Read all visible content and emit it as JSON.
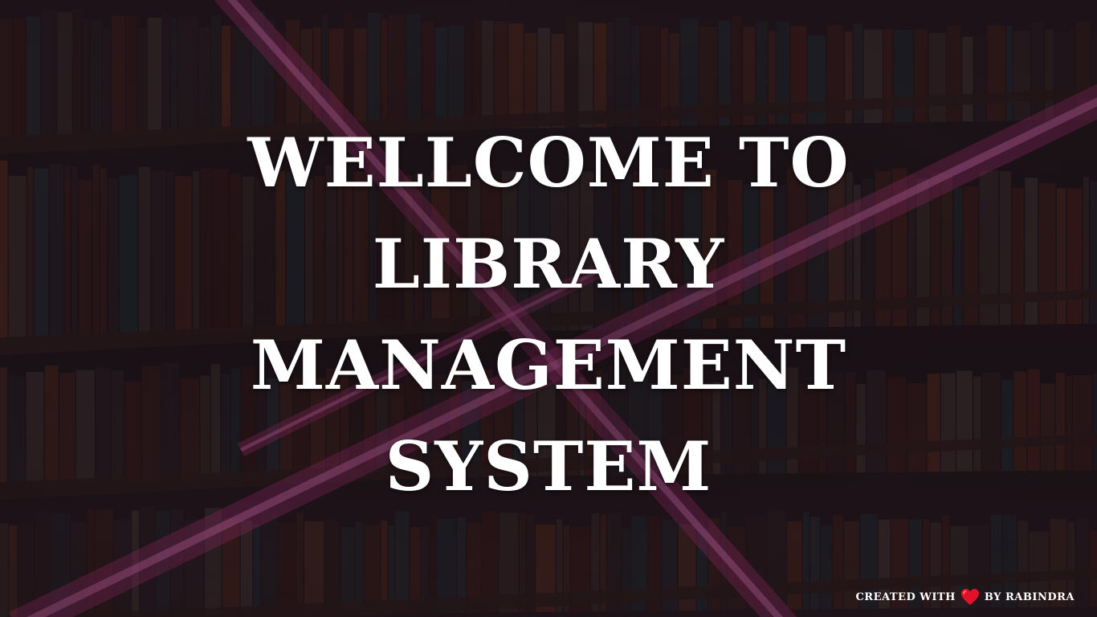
{
  "hero": {
    "line1": "WELLCOME TO",
    "line2": "LIBRARY",
    "line3": "MANAGEMENT",
    "line4": "SYSTEM"
  },
  "footer": {
    "prefix": "CREATED WITH",
    "suffix": "BY RABINDRA",
    "icon": "heart-icon"
  },
  "colors": {
    "text": "#ffffff",
    "accent_lines": "#b0307a",
    "heart": "#e3122a",
    "background": "#1e1519"
  }
}
